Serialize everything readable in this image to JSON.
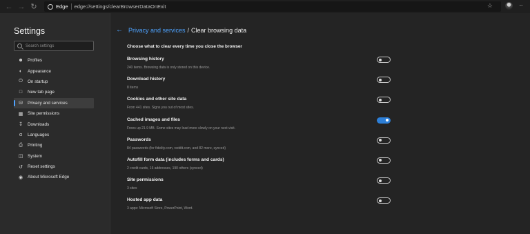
{
  "browser": {
    "app_label": "Edge",
    "url": "edge://settings/clearBrowserDataOnExit"
  },
  "sidebar": {
    "title": "Settings",
    "search_placeholder": "Search settings",
    "items": [
      {
        "label": "Profiles",
        "icon": "person-icon"
      },
      {
        "label": "Appearance",
        "icon": "palette-icon"
      },
      {
        "label": "On startup",
        "icon": "power-icon"
      },
      {
        "label": "New tab page",
        "icon": "new-tab-icon"
      },
      {
        "label": "Privacy and services",
        "icon": "lock-icon",
        "active": true
      },
      {
        "label": "Site permissions",
        "icon": "site-permissions-icon"
      },
      {
        "label": "Downloads",
        "icon": "download-icon"
      },
      {
        "label": "Languages",
        "icon": "languages-icon"
      },
      {
        "label": "Printing",
        "icon": "printer-icon"
      },
      {
        "label": "System",
        "icon": "computer-icon"
      },
      {
        "label": "Reset settings",
        "icon": "reset-icon"
      },
      {
        "label": "About Microsoft Edge",
        "icon": "edge-icon"
      }
    ]
  },
  "main": {
    "breadcrumb_parent": "Privacy and services",
    "breadcrumb_separator": "/",
    "breadcrumb_current": "Clear browsing data",
    "section_heading": "Choose what to clear every time you close the browser",
    "options": [
      {
        "title": "Browsing history",
        "desc": "240 items. Browsing data is only stored on this device.",
        "on": false
      },
      {
        "title": "Download history",
        "desc": "8 items",
        "on": false
      },
      {
        "title": "Cookies and other site data",
        "desc": "From 441 sites. Signs you out of most sites.",
        "on": false
      },
      {
        "title": "Cached images and files",
        "desc": "Frees up 21.9 MB. Some sites may load more slowly on your next visit.",
        "on": true
      },
      {
        "title": "Passwords",
        "desc": "84 passwords (for fidelity.com, reddit.com, and 82 more, synced)",
        "on": false
      },
      {
        "title": "Autofill form data (includes forms and cards)",
        "desc": "2 credit cards, 16 addresses, 190 others (synced)",
        "on": false
      },
      {
        "title": "Site permissions",
        "desc": "3 sites",
        "on": false
      },
      {
        "title": "Hosted app data",
        "desc": "3 apps: Microsoft Store, PowerPoint, Word.",
        "on": false
      }
    ]
  },
  "colors": {
    "accent": "#4ea3ff",
    "toggle_on": "#2d7fd7"
  }
}
